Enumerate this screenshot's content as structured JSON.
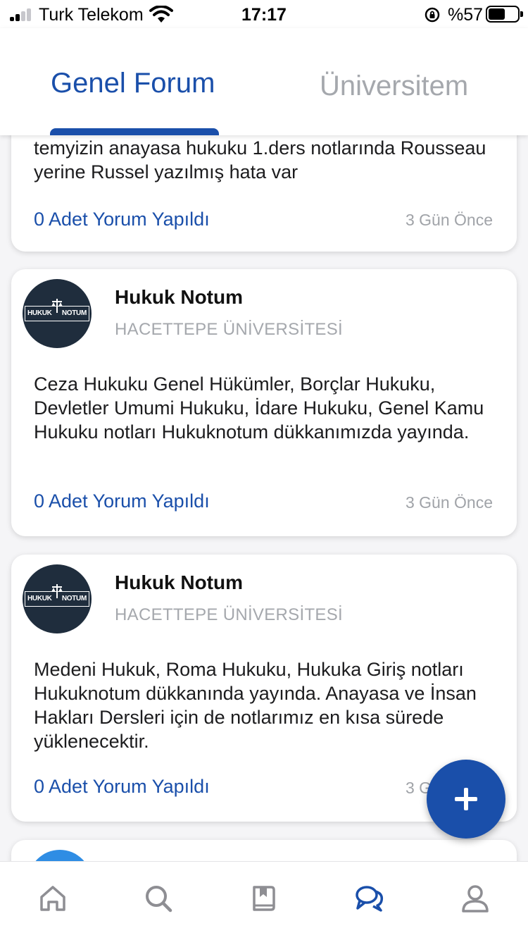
{
  "status_bar": {
    "carrier": "Turk Telekom",
    "time": "17:17",
    "battery": "%57",
    "battery_level": 0.57,
    "signal_bars": 2
  },
  "tabs": {
    "active": "Genel Forum",
    "inactive": "Üniversitem"
  },
  "posts": [
    {
      "text": "temyizin anayasa hukuku 1.ders notlarında Rousseau yerine Russel yazılmış hata var",
      "comments": "0 Adet Yorum Yapıldı",
      "ago": "3 Gün Önce"
    },
    {
      "author": "Hukuk Notum",
      "university": "HACETTEPE ÜNİVERSİTESİ",
      "avatar_logo": "HUKUK NOTUM",
      "text": "Ceza Hukuku Genel Hükümler, Borçlar Hukuku, Devletler Umumi Hukuku, İdare Hukuku, Genel Kamu Hukuku notları Hukuknotum dükkanımızda yayında.",
      "comments": "0 Adet Yorum Yapıldı",
      "ago": "3 Gün Önce"
    },
    {
      "author": "Hukuk Notum",
      "university": "HACETTEPE ÜNİVERSİTESİ",
      "avatar_logo": "HUKUK NOTUM",
      "text": "Medeni Hukuk, Roma Hukuku, Hukuka Giriş notları Hukuknotum dükkanında yayında. Anayasa ve İnsan Hakları Dersleri için de notlarımız en kısa sürede yüklenecektir.",
      "comments": "0 Adet Yorum Yapıldı",
      "ago": "3 Gün Önce"
    }
  ],
  "fab": {
    "icon": "plus-icon"
  },
  "bottom_nav": [
    {
      "icon": "home-icon",
      "active": false
    },
    {
      "icon": "search-icon",
      "active": false
    },
    {
      "icon": "bookmark-book-icon",
      "active": false
    },
    {
      "icon": "chat-bubbles-icon",
      "active": true
    },
    {
      "icon": "user-icon",
      "active": false
    }
  ],
  "colors": {
    "accent": "#1a4faa",
    "inactive_tab": "#a5a8ad",
    "muted_text": "#a0a3a8",
    "avatar_bg": "#1f2d3d",
    "background": "#f5f5f7"
  }
}
